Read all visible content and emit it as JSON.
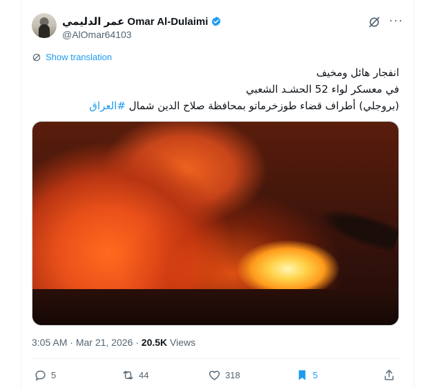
{
  "author": {
    "name": "عمر الدليمي Omar Al-Dulaimi",
    "handle": "@AlOmar64103",
    "verified": true
  },
  "translate": {
    "label": "Show translation"
  },
  "tweet": {
    "line1": "انفجار هائل ومخيف",
    "line2": "في معسكر لواء 52 الحشـد الشعبي",
    "line3_text": "(بروجلي) أطراف قضاء طوزخرماتو بمحافظة صلاح الدين شمال ",
    "hashtag": "#العراق"
  },
  "meta": {
    "time": "3:05 AM",
    "sep": "·",
    "date": "Mar 21, 2026",
    "views_count": "20.5K",
    "views_label": "Views"
  },
  "actions": {
    "replies": "5",
    "reposts": "44",
    "likes": "318",
    "bookmarks": "5"
  },
  "colors": {
    "accent": "#1d9bf0",
    "secondary_text": "#536471"
  }
}
